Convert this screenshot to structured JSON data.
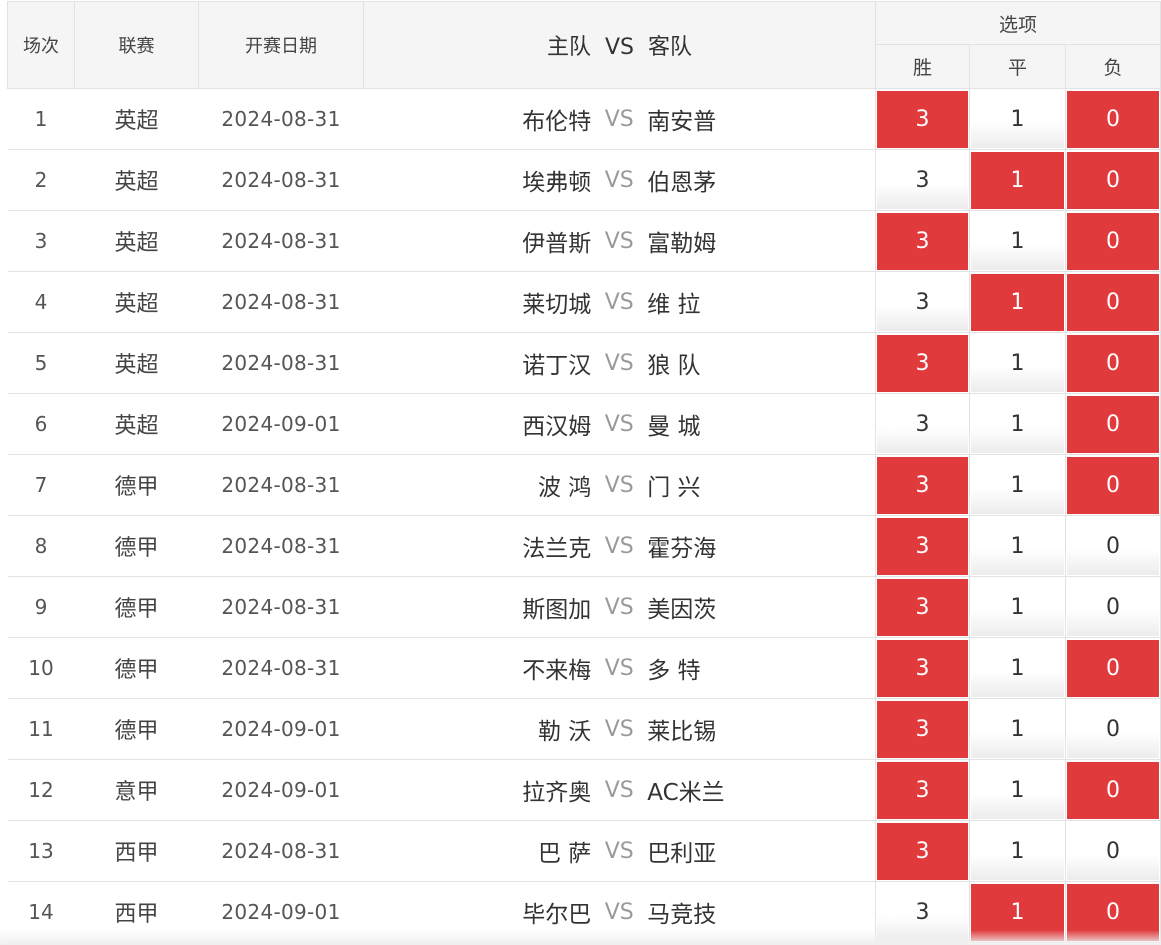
{
  "header": {
    "col_no": "场次",
    "col_league": "联赛",
    "col_date": "开赛日期",
    "col_home": "主队",
    "col_vs": "VS",
    "col_away": "客队",
    "col_options": "选项",
    "opt_win": "胜",
    "opt_draw": "平",
    "opt_lose": "负"
  },
  "colors": {
    "selected": "#e03a3c",
    "header_bg": "#f5f5f5"
  },
  "matches": [
    {
      "no": "1",
      "league": "英超",
      "date": "2024-08-31",
      "home": "布伦特",
      "vs": "VS",
      "away": "南安普",
      "win": "3",
      "draw": "1",
      "lose": "0",
      "sel": [
        true,
        false,
        true
      ]
    },
    {
      "no": "2",
      "league": "英超",
      "date": "2024-08-31",
      "home": "埃弗顿",
      "vs": "VS",
      "away": "伯恩茅",
      "win": "3",
      "draw": "1",
      "lose": "0",
      "sel": [
        false,
        true,
        true
      ]
    },
    {
      "no": "3",
      "league": "英超",
      "date": "2024-08-31",
      "home": "伊普斯",
      "vs": "VS",
      "away": "富勒姆",
      "win": "3",
      "draw": "1",
      "lose": "0",
      "sel": [
        true,
        false,
        true
      ]
    },
    {
      "no": "4",
      "league": "英超",
      "date": "2024-08-31",
      "home": "莱切城",
      "vs": "VS",
      "away": "维 拉",
      "win": "3",
      "draw": "1",
      "lose": "0",
      "sel": [
        false,
        true,
        true
      ]
    },
    {
      "no": "5",
      "league": "英超",
      "date": "2024-08-31",
      "home": "诺丁汉",
      "vs": "VS",
      "away": "狼 队",
      "win": "3",
      "draw": "1",
      "lose": "0",
      "sel": [
        true,
        false,
        true
      ]
    },
    {
      "no": "6",
      "league": "英超",
      "date": "2024-09-01",
      "home": "西汉姆",
      "vs": "VS",
      "away": "曼 城",
      "win": "3",
      "draw": "1",
      "lose": "0",
      "sel": [
        false,
        false,
        true
      ]
    },
    {
      "no": "7",
      "league": "德甲",
      "date": "2024-08-31",
      "home": "波 鸿",
      "vs": "VS",
      "away": "门 兴",
      "win": "3",
      "draw": "1",
      "lose": "0",
      "sel": [
        true,
        false,
        true
      ]
    },
    {
      "no": "8",
      "league": "德甲",
      "date": "2024-08-31",
      "home": "法兰克",
      "vs": "VS",
      "away": "霍芬海",
      "win": "3",
      "draw": "1",
      "lose": "0",
      "sel": [
        true,
        false,
        false
      ]
    },
    {
      "no": "9",
      "league": "德甲",
      "date": "2024-08-31",
      "home": "斯图加",
      "vs": "VS",
      "away": "美因茨",
      "win": "3",
      "draw": "1",
      "lose": "0",
      "sel": [
        true,
        false,
        false
      ]
    },
    {
      "no": "10",
      "league": "德甲",
      "date": "2024-08-31",
      "home": "不来梅",
      "vs": "VS",
      "away": "多 特",
      "win": "3",
      "draw": "1",
      "lose": "0",
      "sel": [
        true,
        false,
        true
      ]
    },
    {
      "no": "11",
      "league": "德甲",
      "date": "2024-09-01",
      "home": "勒 沃",
      "vs": "VS",
      "away": "莱比锡",
      "win": "3",
      "draw": "1",
      "lose": "0",
      "sel": [
        true,
        false,
        false
      ]
    },
    {
      "no": "12",
      "league": "意甲",
      "date": "2024-09-01",
      "home": "拉齐奥",
      "vs": "VS",
      "away": "AC米兰",
      "win": "3",
      "draw": "1",
      "lose": "0",
      "sel": [
        true,
        false,
        true
      ]
    },
    {
      "no": "13",
      "league": "西甲",
      "date": "2024-08-31",
      "home": "巴 萨",
      "vs": "VS",
      "away": "巴利亚",
      "win": "3",
      "draw": "1",
      "lose": "0",
      "sel": [
        true,
        false,
        false
      ]
    },
    {
      "no": "14",
      "league": "西甲",
      "date": "2024-09-01",
      "home": "毕尔巴",
      "vs": "VS",
      "away": "马竞技",
      "win": "3",
      "draw": "1",
      "lose": "0",
      "sel": [
        false,
        true,
        true
      ]
    }
  ]
}
